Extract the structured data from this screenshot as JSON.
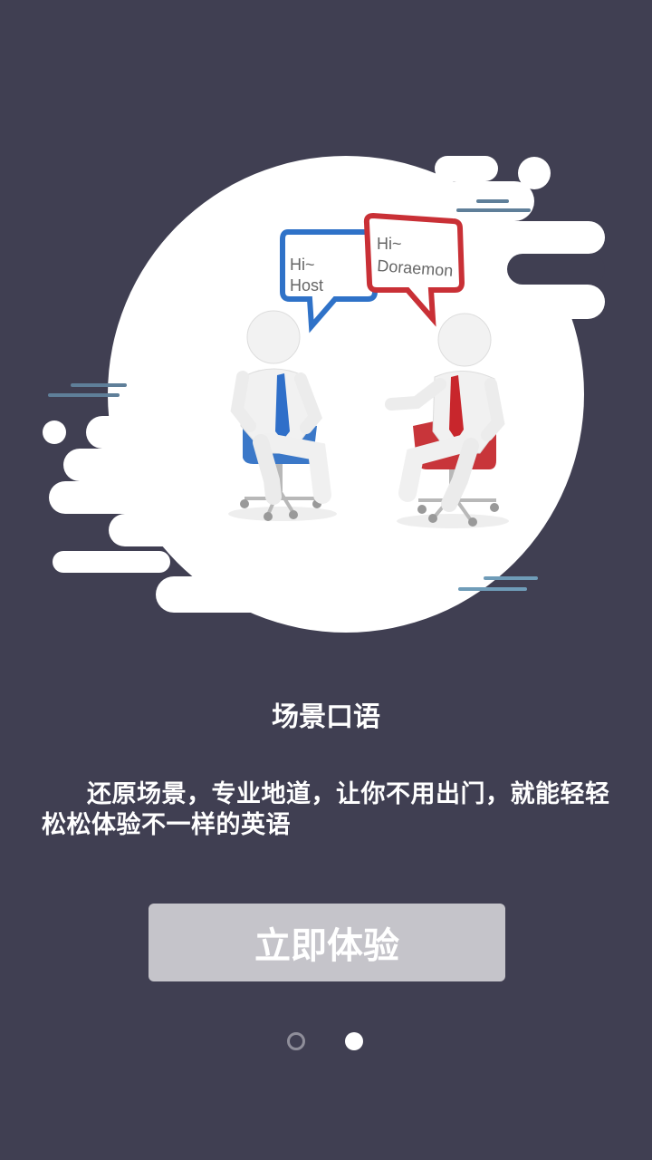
{
  "illustration": {
    "bubble_left": {
      "line1": "Hi~",
      "line2": "Host"
    },
    "bubble_right": {
      "line1": "Hi~",
      "line2": "Doraemon"
    }
  },
  "page": {
    "title": "场景口语",
    "description": "还原场景，专业地道，让你不用出门，就能轻轻松松体验不一样的英语",
    "cta_label": "立即体验"
  },
  "pager": {
    "total": 2,
    "active_index": 2
  },
  "colors": {
    "background": "#403f52",
    "button": "#c5c4ca",
    "tie_blue": "#2f6fc9",
    "tie_red": "#c8262c",
    "bubble_blue": "#2f72c8",
    "bubble_red": "#c93036"
  }
}
